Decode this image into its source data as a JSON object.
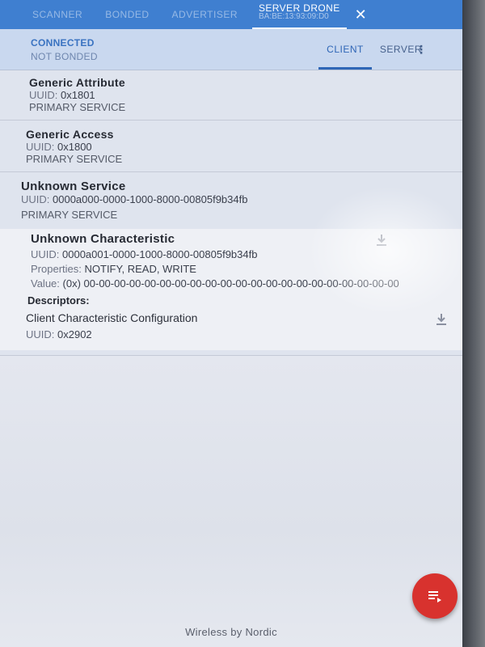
{
  "appbar": {
    "tabs": [
      "SCANNER",
      "BONDED",
      "ADVERTISER"
    ],
    "device_name": "SERVER DRONE",
    "device_address": "BA:BE:13:93:09:D0"
  },
  "status": {
    "connection": "CONNECTED",
    "bond": "NOT BONDED"
  },
  "mode_tabs": {
    "client": "CLIENT",
    "server": "SERVER"
  },
  "services": [
    {
      "name": "Generic Attribute",
      "uuid_key": "UUID:",
      "uuid": "0x1801",
      "type": "PRIMARY SERVICE"
    },
    {
      "name": "Generic Access",
      "uuid_key": "UUID:",
      "uuid": "0x1800",
      "type": "PRIMARY SERVICE"
    },
    {
      "name": "Unknown Service",
      "uuid_key": "UUID:",
      "uuid": "0000a000-0000-1000-8000-00805f9b34fb",
      "type": "PRIMARY SERVICE"
    }
  ],
  "characteristic": {
    "name": "Unknown Characteristic",
    "uuid_key": "UUID:",
    "uuid": "0000a001-0000-1000-8000-00805f9b34fb",
    "properties_key": "Properties:",
    "properties": "NOTIFY, READ, WRITE",
    "value_key": "Value:",
    "value": "(0x) 00-00-00-00-00-00-00-00-00-00-00-00-00-00-00-00-00-00-00-00-00",
    "descriptors_label": "Descriptors:",
    "descriptor": {
      "name": "Client Characteristic Configuration",
      "uuid_key": "UUID:",
      "uuid": "0x2902"
    }
  },
  "footer": "Wireless by Nordic",
  "icons": {
    "close": "close-icon",
    "overflow": "more-vert-icon",
    "read": "download-icon",
    "fab": "log-list-icon"
  },
  "colors": {
    "appbar": "#3f7fd0",
    "statusbar": "#c9d8ef",
    "accent": "#2f66b6",
    "fab": "#d8322e"
  }
}
